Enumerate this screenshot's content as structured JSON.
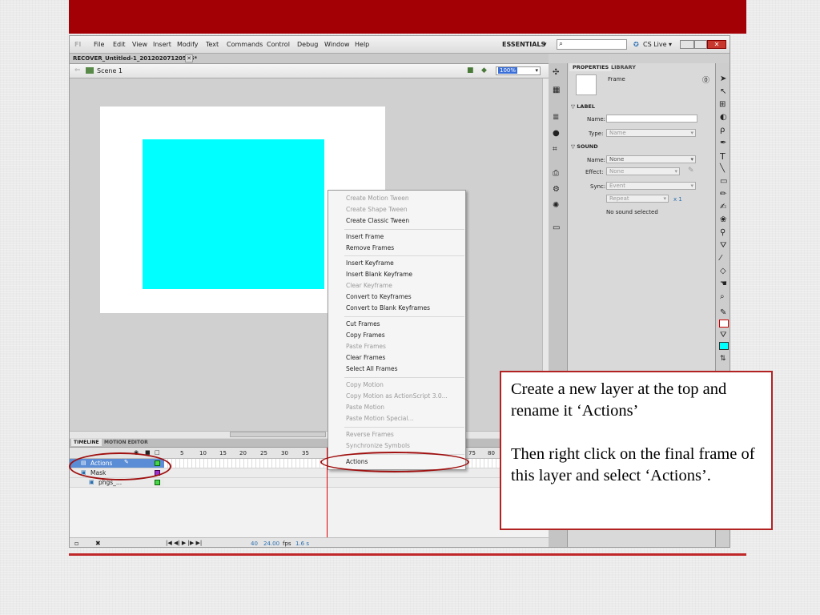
{
  "slide": {
    "top_bar_color": "#a30006",
    "rule_color": "#c0282a"
  },
  "app": {
    "logo": "Fl",
    "menus": [
      "File",
      "Edit",
      "View",
      "Insert",
      "Modify",
      "Text",
      "Commands",
      "Control",
      "Debug",
      "Window",
      "Help"
    ],
    "workspace": "ESSENTIALS",
    "search_placeholder": "",
    "cs_live": "CS Live",
    "doc_tab": "RECOVER_Untitled-1_20120207120545*",
    "scene": "Scene 1",
    "zoom": "100%",
    "stage_rect_color": "#00ffff"
  },
  "timeline": {
    "tabs": [
      "TIMELINE",
      "MOTION EDITOR"
    ],
    "ruler": [
      "5",
      "10",
      "15",
      "20",
      "25",
      "30",
      "35",
      "75",
      "80"
    ],
    "layers": [
      {
        "name": "Actions"
      },
      {
        "name": "Mask"
      },
      {
        "name": "phgs_..."
      }
    ],
    "fps": "24.00",
    "fps_unit": "fps",
    "time": "1.6 s",
    "frame": "40"
  },
  "panel": {
    "tabs": [
      "PROPERTIES",
      "LIBRARY"
    ],
    "type_label": "Frame",
    "label_section": "LABEL",
    "name_label": "Name:",
    "type_field_label": "Type:",
    "type_value": "Name",
    "sound_section": "SOUND",
    "sound_name_label": "Name:",
    "sound_name_value": "None",
    "effect_label": "Effect:",
    "effect_value": "None",
    "sync_label": "Sync:",
    "sync_value": "Event",
    "repeat_value": "Repeat",
    "repeat_count": "x 1",
    "no_sound": "No sound selected"
  },
  "context_menu": [
    {
      "label": "Create Motion Tween",
      "enabled": false
    },
    {
      "label": "Create Shape Tween",
      "enabled": false
    },
    {
      "label": "Create Classic Tween",
      "enabled": true
    },
    {
      "label": "Insert Frame",
      "enabled": true
    },
    {
      "label": "Remove Frames",
      "enabled": true
    },
    {
      "label": "Insert Keyframe",
      "enabled": true
    },
    {
      "label": "Insert Blank Keyframe",
      "enabled": true
    },
    {
      "label": "Clear Keyframe",
      "enabled": false
    },
    {
      "label": "Convert to Keyframes",
      "enabled": true
    },
    {
      "label": "Convert to Blank Keyframes",
      "enabled": true
    },
    {
      "label": "Cut Frames",
      "enabled": true
    },
    {
      "label": "Copy Frames",
      "enabled": true
    },
    {
      "label": "Paste Frames",
      "enabled": false
    },
    {
      "label": "Clear Frames",
      "enabled": true
    },
    {
      "label": "Select All Frames",
      "enabled": true
    },
    {
      "label": "Copy Motion",
      "enabled": false
    },
    {
      "label": "Copy Motion as ActionScript 3.0...",
      "enabled": false
    },
    {
      "label": "Paste Motion",
      "enabled": false
    },
    {
      "label": "Paste Motion Special...",
      "enabled": false
    },
    {
      "label": "Reverse Frames",
      "enabled": false
    },
    {
      "label": "Synchronize Symbols",
      "enabled": false
    },
    {
      "label": "Actions",
      "enabled": true
    }
  ],
  "callout": {
    "line1": "Create a new layer at the top and rename it ‘Actions’",
    "line2": "Then right click on the final frame of this layer and select ‘Actions’."
  }
}
